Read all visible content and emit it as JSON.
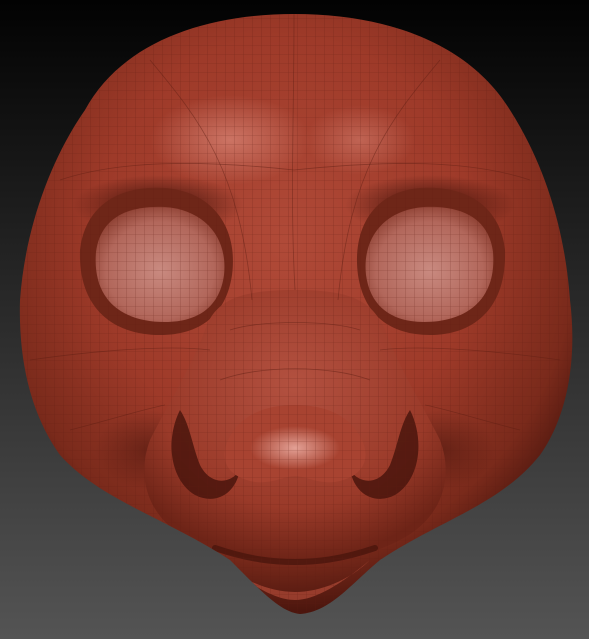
{
  "viewport": {
    "background_top": "#020202",
    "background_bottom": "#545454"
  },
  "model": {
    "material_color": "#9e3a29",
    "material_dark": "#4a150d",
    "highlight": "#e6a59a",
    "wire_color": "#5c1c12"
  }
}
